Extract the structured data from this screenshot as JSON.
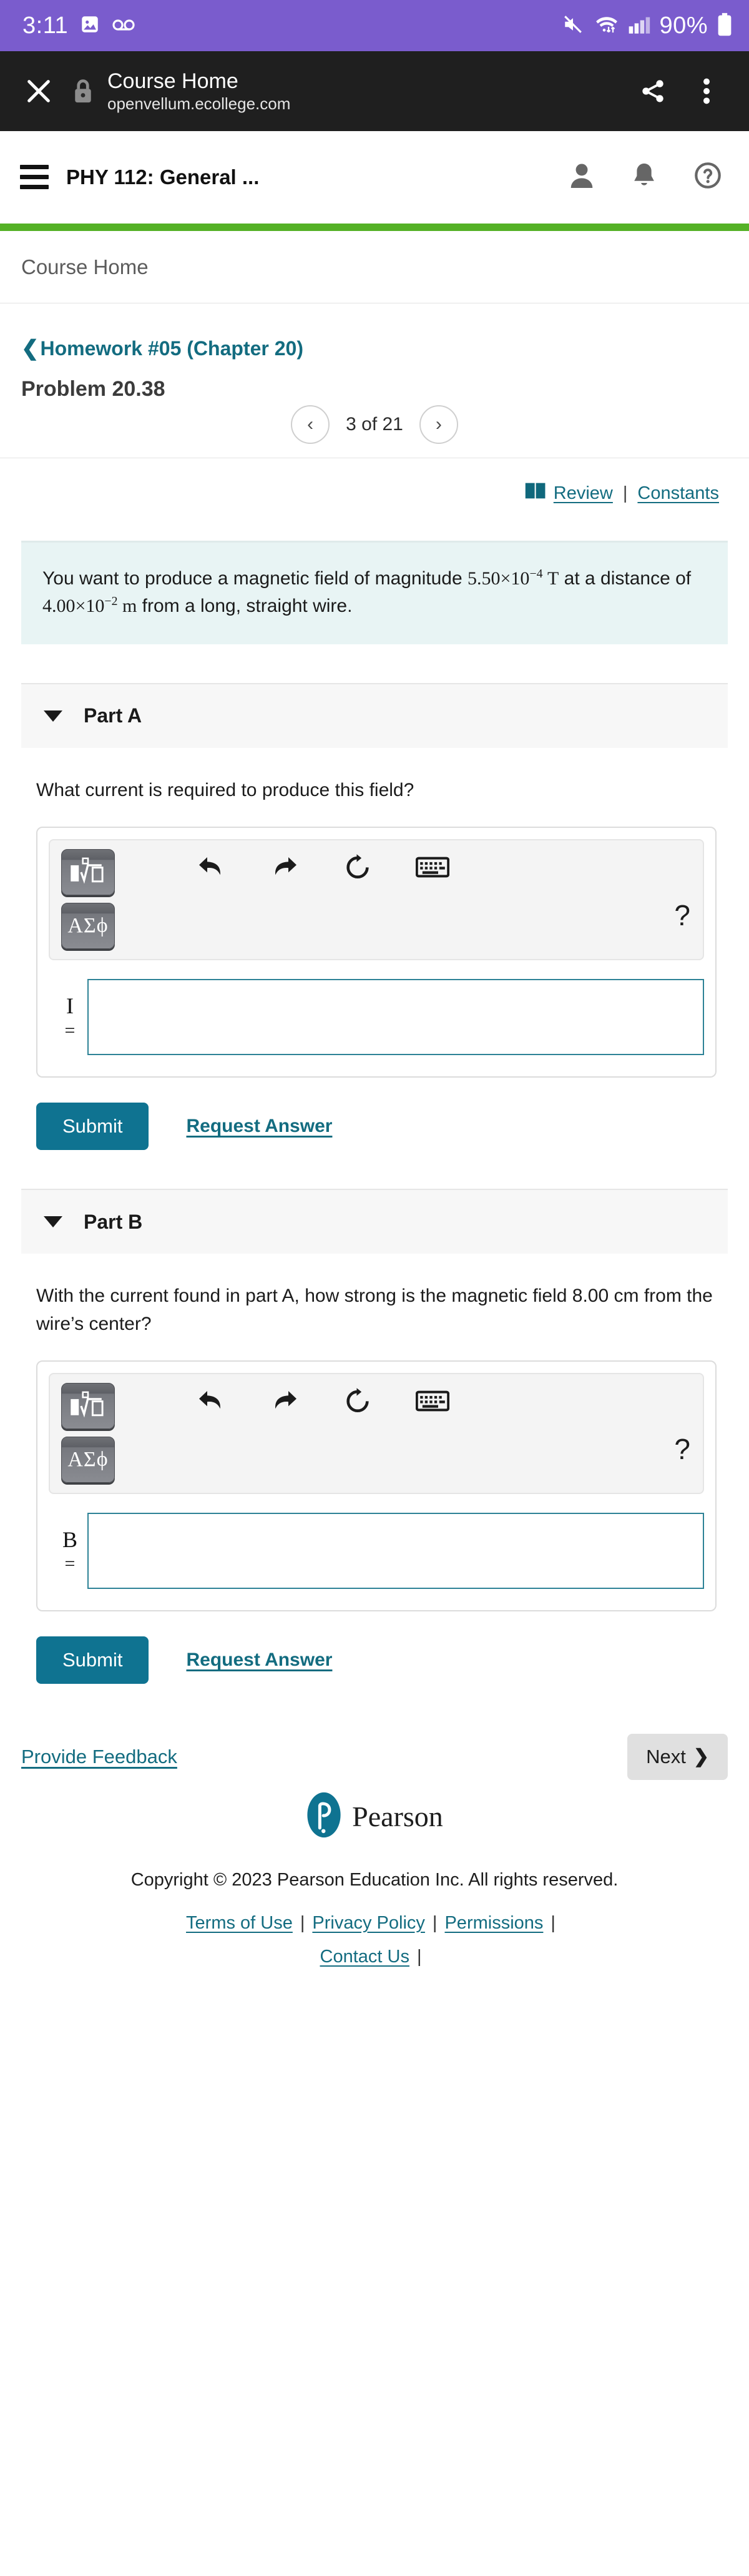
{
  "status_bar": {
    "time": "3:11",
    "battery_percent": "90%",
    "icons": [
      "photo-icon",
      "voicemail-icon",
      "mute-icon",
      "wifi-icon",
      "signal-icon",
      "battery-icon"
    ]
  },
  "browser_bar": {
    "title": "Course Home",
    "url": "openvellum.ecollege.com",
    "close_label": "✕",
    "icons": [
      "close-icon",
      "lock-icon",
      "share-icon",
      "overflow-menu-icon"
    ]
  },
  "app_header": {
    "course_title": "PHY 112: General ...",
    "icons": [
      "menu-icon",
      "account-icon",
      "notifications-icon",
      "help-icon"
    ],
    "progress_color": "#54b126"
  },
  "breadcrumb": {
    "label": "Course Home"
  },
  "assignment": {
    "back_chevron": "❮",
    "homework_label": "Homework #05 (Chapter 20)",
    "problem_label": "Problem 20.38",
    "pager": {
      "prev": "‹",
      "next": "›",
      "label": "3 of 21",
      "current": 3,
      "total": 21
    }
  },
  "resources": {
    "review_label": "Review",
    "separator": "|",
    "constants_label": "Constants",
    "book_icon": "book-icon"
  },
  "problem_statement": {
    "text_before": "You want to produce a magnetic field of magnitude ",
    "field_mantissa": "5.50×10",
    "field_exponent": "−4",
    "field_unit": "T",
    "text_middle": " at a distance of ",
    "distance_mantissa": "4.00×10",
    "distance_exponent": "−2",
    "distance_unit": "m",
    "text_after": " from a long, straight wire."
  },
  "parts": [
    {
      "label": "Part A",
      "question": "What current is required to produce this field?",
      "variable": "I",
      "equals": "=",
      "answer_value": "",
      "submit_label": "Submit",
      "request_answer_label": "Request Answer",
      "toolbar": {
        "template_button": "math-template-icon",
        "greek_button": "ΑΣϕ",
        "undo": "undo-icon",
        "redo": "redo-icon",
        "reset": "reset-icon",
        "keyboard": "keyboard-icon",
        "help": "?"
      }
    },
    {
      "label": "Part B",
      "question": "With the current found in part A, how strong is the magnetic field 8.00 cm from the wire’s center?",
      "variable": "B",
      "equals": "=",
      "answer_value": "",
      "submit_label": "Submit",
      "request_answer_label": "Request Answer",
      "toolbar": {
        "template_button": "math-template-icon",
        "greek_button": "ΑΣϕ",
        "undo": "undo-icon",
        "redo": "redo-icon",
        "reset": "reset-icon",
        "keyboard": "keyboard-icon",
        "help": "?"
      }
    }
  ],
  "footer": {
    "feedback_label": "Provide Feedback",
    "next_label": "Next",
    "next_chevron": "❯",
    "brand_name": "Pearson",
    "copyright": "Copyright © 2023 Pearson Education Inc. All rights reserved.",
    "links": [
      {
        "label": "Terms of Use"
      },
      {
        "label": "Privacy Policy"
      },
      {
        "label": "Permissions"
      },
      {
        "label": "Contact Us"
      }
    ],
    "link_separator": "|"
  },
  "colors": {
    "status_bar": "#7a5ccd",
    "browser_bar": "#1f1f1f",
    "accent_teal": "#136c80",
    "submit_blue": "#0f7391",
    "progress_green": "#54b126",
    "statement_bg": "#e8f4f4"
  }
}
